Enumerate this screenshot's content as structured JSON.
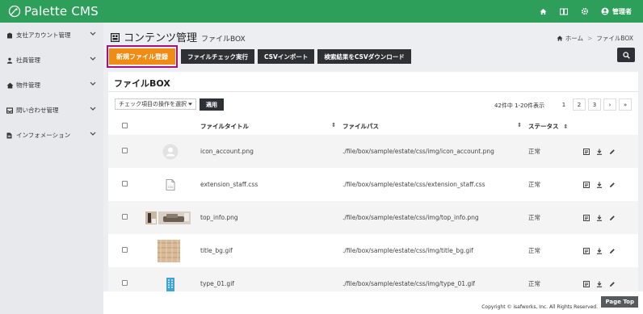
{
  "app": {
    "name": "Palette CMS",
    "user": "管理者"
  },
  "sidebar": {
    "items": [
      {
        "label": "支社アカウント管理",
        "icon": "building-icon"
      },
      {
        "label": "社員管理",
        "icon": "person-icon"
      },
      {
        "label": "物件管理",
        "icon": "house-icon"
      },
      {
        "label": "問い合わせ管理",
        "icon": "inbox-icon"
      },
      {
        "label": "インフォメーション",
        "icon": "document-icon"
      }
    ]
  },
  "page": {
    "title": "コンテンツ管理",
    "subtitle": "ファイルBOX"
  },
  "breadcrumb": {
    "home": "ホーム",
    "separator": ">",
    "current": "ファイルBOX"
  },
  "toolbar": {
    "new_file": "新規ファイル登録",
    "file_check": "ファイルチェック実行",
    "csv_import": "CSVインポート",
    "csv_download": "検索結果をCSVダウンロード"
  },
  "panel": {
    "title": "ファイルBOX"
  },
  "bulk": {
    "select_label": "チェック項目の操作を選択",
    "apply_label": "適用"
  },
  "pagination": {
    "range_text": "42件中 1-20件表示",
    "pages": [
      "1",
      "2",
      "3"
    ],
    "next": "›",
    "last": "»"
  },
  "table": {
    "headers": {
      "title": "ファイルタイトル",
      "path": "ファイルパス",
      "status": "ステータス"
    },
    "rows": [
      {
        "title": "icon_account.png",
        "path": "./file/box/sample/estate/css/img/icon_account.png",
        "status": "正常",
        "thumb": "account"
      },
      {
        "title": "extension_staff.css",
        "path": "./file/box/sample/estate/css/extension_staff.css",
        "status": "正常",
        "thumb": "css"
      },
      {
        "title": "top_info.png",
        "path": "./file/box/sample/estate/css/img/top_info.png",
        "status": "正常",
        "thumb": "photo"
      },
      {
        "title": "title_bg.gif",
        "path": "./file/box/sample/estate/css/img/title_bg.gif",
        "status": "正常",
        "thumb": "pattern"
      },
      {
        "title": "type_01.gif",
        "path": "./file/box/sample/estate/css/img/type_01.gif",
        "status": "正常",
        "thumb": "building"
      }
    ]
  },
  "footer": {
    "copyright": "Copyright © isafworks, Inc. All Rights Reserved.",
    "page_top": "Page Top"
  },
  "colors": {
    "brand": "#2e9f5a",
    "accent": "#f08c14",
    "dark": "#2d3136",
    "highlight": "#a2117e"
  }
}
